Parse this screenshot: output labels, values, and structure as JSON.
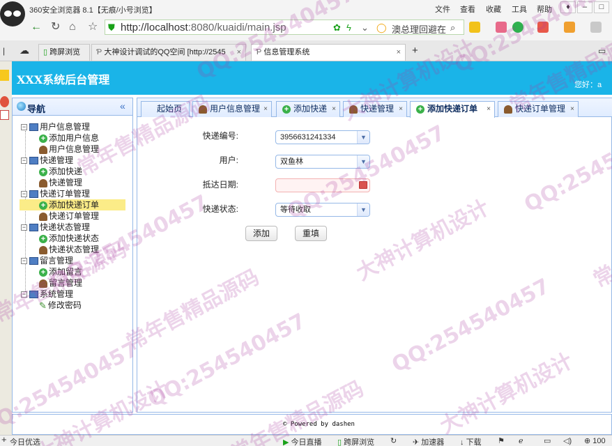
{
  "browser": {
    "title": "360安全浏览器 8.1【无痕/小号浏览】",
    "menu": [
      "文件",
      "查看",
      "收藏",
      "工具",
      "帮助"
    ],
    "url_host": "http://localhost",
    "url_path": ":8080/kuaidi/main.jsp",
    "search_text": "澳总理回避在",
    "tabs": [
      {
        "label": "跨屏浏览"
      },
      {
        "label": "大神设计调试的QQ空间 [http://2545"
      },
      {
        "label": "信息管理系统"
      }
    ],
    "new_tab": "+"
  },
  "app": {
    "title": "XXX系统后台管理",
    "greeting": "您好：a"
  },
  "nav": {
    "title": "导航",
    "collapse": "«",
    "groups": [
      {
        "label": "用户信息管理",
        "items": [
          "添加用户信息",
          "用户信息管理"
        ]
      },
      {
        "label": "快递管理",
        "items": [
          "添加快递",
          "快递管理"
        ]
      },
      {
        "label": "快递订单管理",
        "items": [
          "添加快递订单",
          "快递订单管理"
        ]
      },
      {
        "label": "快递状态管理",
        "items": [
          "添加快递状态",
          "快递状态管理"
        ]
      },
      {
        "label": "留言管理",
        "items": [
          "添加留言",
          "留言管理"
        ]
      },
      {
        "label": "系统管理",
        "items": [
          "修改密码"
        ]
      }
    ],
    "selected": "添加快递订单"
  },
  "content_tabs": [
    {
      "label": "起始页"
    },
    {
      "label": "用户信息管理"
    },
    {
      "label": "添加快递"
    },
    {
      "label": "快递管理"
    },
    {
      "label": "添加快递订单"
    },
    {
      "label": "快递订单管理"
    }
  ],
  "form": {
    "express_no_label": "快递编号:",
    "express_no_value": "3956631241334",
    "user_label": "用户:",
    "user_value": "双鱼林",
    "date_label": "抵达日期:",
    "date_value": "",
    "status_label": "快递状态:",
    "status_value": "等待收取",
    "add_button": "添加",
    "reset_button": "重填"
  },
  "footer": {
    "text": "© Powered by dashen"
  },
  "statusbar": {
    "left": "今日优选",
    "items": [
      "今日直播",
      "跨屏浏览",
      "加速器",
      "下载"
    ],
    "zoom": "100"
  },
  "watermarks": [
    "QQ:254540457",
    "大神计算机设计",
    "常年售精品源码"
  ],
  "colors": {
    "header": "#1ab4e8",
    "panel_border": "#95b8e7",
    "selected": "#fbec88"
  }
}
